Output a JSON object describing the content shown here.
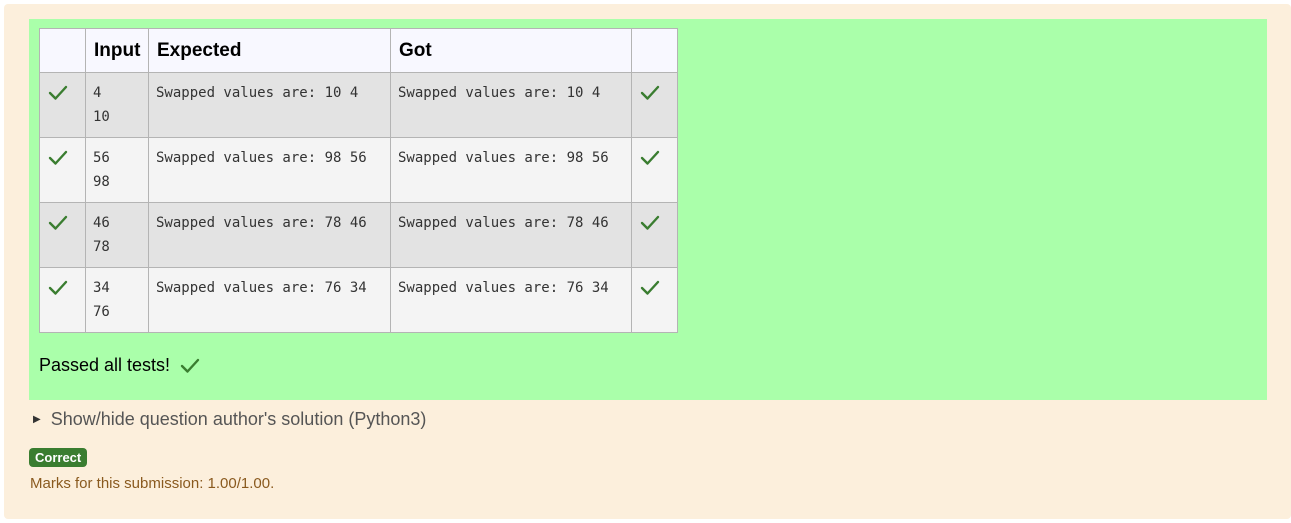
{
  "table": {
    "headers": {
      "input": "Input",
      "expected": "Expected",
      "got": "Got"
    },
    "rows": [
      {
        "input": "4\n10",
        "expected": "Swapped values are: 10 4",
        "got": "Swapped values are: 10 4",
        "pass": true
      },
      {
        "input": "56\n98",
        "expected": "Swapped values are: 98 56",
        "got": "Swapped values are: 98 56",
        "pass": true
      },
      {
        "input": "46\n78",
        "expected": "Swapped values are: 78 46",
        "got": "Swapped values are: 78 46",
        "pass": true
      },
      {
        "input": "34\n76",
        "expected": "Swapped values are: 76 34",
        "got": "Swapped values are: 76 34",
        "pass": true
      }
    ]
  },
  "summary": {
    "passed_text": "Passed all tests!"
  },
  "solution_toggle": {
    "label": "Show/hide question author's solution (Python3)"
  },
  "grade": {
    "badge": "Correct",
    "marks_text": "Marks for this submission: 1.00/1.00."
  },
  "colors": {
    "panel_green": "#aaffaa",
    "outer_bg": "#fcefdc",
    "check_green": "#3a7d30",
    "badge_green": "#3a7d30"
  },
  "icons": {
    "pass": "check-icon",
    "toggle": "triangle-right-icon"
  }
}
